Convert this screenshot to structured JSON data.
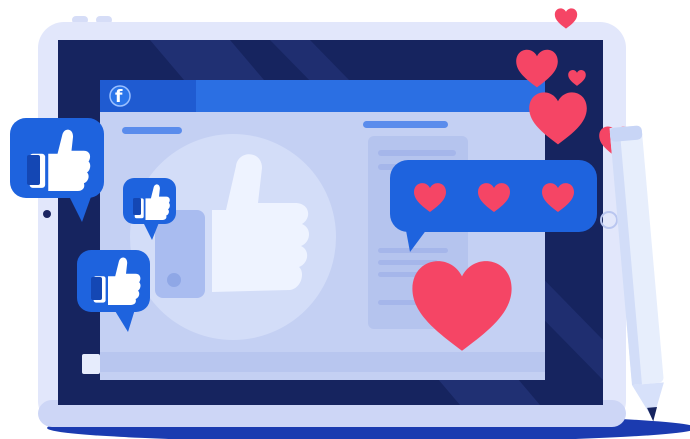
{
  "app": {
    "logo_letter": "f"
  },
  "colors": {
    "accent_blue": "#1f6ee0",
    "dark_blue": "#1447b4",
    "tablet_frame": "#e2e7fb",
    "screen_dark": "#16245f",
    "page_background": "#c4d0f3",
    "heart_red": "#f54565",
    "heart_pink": "#ff6b86",
    "pencil_light": "#e7eefc",
    "floor_shadow": "#1b3bb0"
  },
  "icons": [
    "thumbs-up-icon",
    "heart-icon",
    "facebook-logo-icon",
    "pencil-icon",
    "speech-bubble-icon"
  ],
  "reactions": {
    "hearts_in_bubble": 3,
    "floating_like_bubbles": 3,
    "floating_hearts": 4
  }
}
